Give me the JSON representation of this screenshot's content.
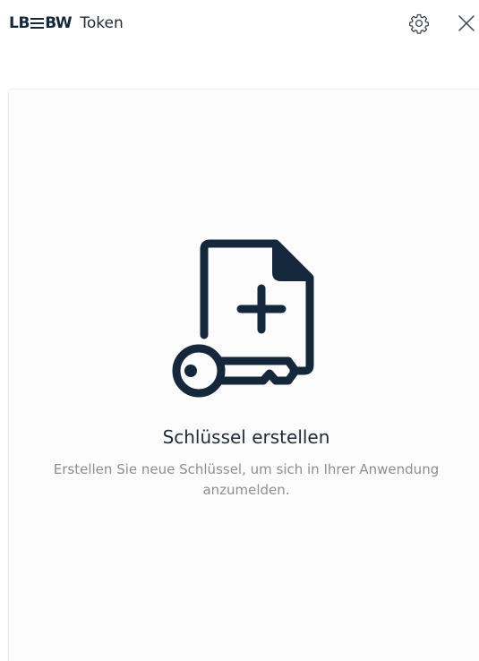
{
  "header": {
    "logo_left": "LB",
    "logo_right": "BW",
    "app_name": "Token"
  },
  "icons": {
    "settings": "gear-icon",
    "close": "close-icon",
    "illustration": "key-document-add-icon"
  },
  "empty_state": {
    "title": "Schlüssel erstellen",
    "description": "Erstellen Sie neue Schlüssel, um sich in Ihrer Anwendung anzumelden."
  },
  "colors": {
    "brand": "#15273b",
    "title": "#1f2a36",
    "description": "#8a8f95",
    "card_background": "#fcfcfc"
  }
}
